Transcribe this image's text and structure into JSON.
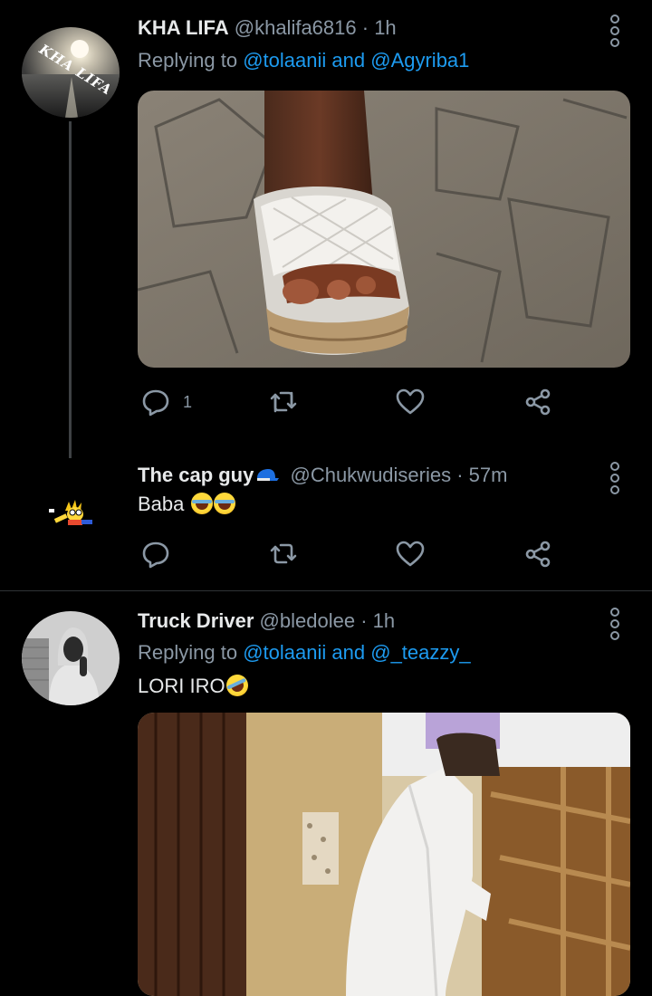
{
  "tweets": [
    {
      "name": "KHA LIFA",
      "handle": "@khalifa6816",
      "time": "· 1h",
      "replying_prefix": "Replying to",
      "mention1": "@tolaanii",
      "and_word": "and",
      "mention2": "@Agyriba1",
      "avatar_text": "KHA LIFA",
      "reply_count": "1"
    },
    {
      "name": "The cap guy",
      "handle": "@Chukwudiseries",
      "time": "· 57m",
      "text": "Baba"
    },
    {
      "name": "Truck Driver",
      "handle": "@bledolee",
      "time": "· 1h",
      "replying_prefix": "Replying to",
      "mention1": "@tolaanii",
      "and_word": "and",
      "mention2": "@_teazzy_",
      "text": "LORI IRO"
    }
  ],
  "colors": {
    "background": "#000000",
    "text": "#e7e9ea",
    "secondary": "#8b98a5",
    "link": "#1d9bf0",
    "divider": "#2f3336"
  },
  "icons": [
    "reply-icon",
    "retweet-icon",
    "like-icon",
    "share-icon",
    "more-icon"
  ]
}
